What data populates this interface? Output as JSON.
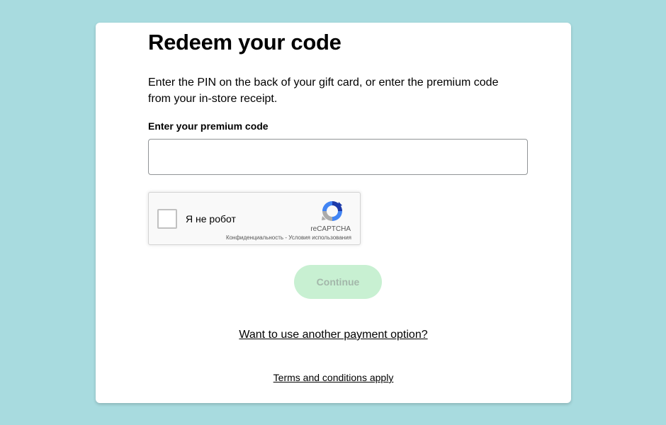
{
  "page": {
    "title": "Redeem your code",
    "description": "Enter the PIN on the back of your gift card, or enter the premium code from your in-store receipt."
  },
  "form": {
    "code_label": "Enter your premium code",
    "code_value": "",
    "code_placeholder": ""
  },
  "recaptcha": {
    "checkbox_label": "Я не робот",
    "brand": "reCAPTCHA",
    "privacy_link": "Конфиденциальность",
    "separator": " - ",
    "terms_link": "Условия использования",
    "icon": "recaptcha-logo",
    "checked": false
  },
  "actions": {
    "continue_label": "Continue",
    "continue_enabled": false
  },
  "links": {
    "other_payment": "Want to use another payment option?",
    "terms": "Terms and conditions apply"
  },
  "colors": {
    "background": "#a8dbdf",
    "card": "#ffffff",
    "button_disabled_bg": "#c8f0d2",
    "button_disabled_text": "#a3b7aa"
  }
}
